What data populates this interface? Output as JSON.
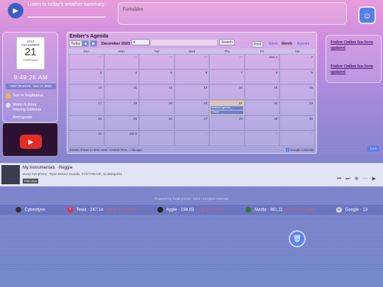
{
  "audio": {
    "text": "Listen to today's weather summary"
  },
  "forbidden": {
    "text": "Forbidden"
  },
  "date": {
    "year": "2023",
    "month": "DECEMBER",
    "day": "21",
    "weekday": "THURSDAY",
    "time": "9:49:26 AM",
    "gmt": "GMT 09:49:26 · Dec 21 2023"
  },
  "astro": [
    {
      "label": "Sun in Sagittarius",
      "color": "#e8c040"
    },
    {
      "label": "Moon in Aries",
      "color": "#dddddd"
    },
    {
      "label": "Waxing Gibbous",
      "color": "#888888"
    },
    {
      "label": "Retrograde",
      "color": "#aa88ee"
    }
  ],
  "calendar": {
    "title": "Ember's Agenda",
    "today_label": "Today",
    "month_label": "December 2023",
    "print_label": "Print",
    "week_label": "Week",
    "month_view_label": "Month",
    "agenda_label": "Agenda",
    "search_label": "Search",
    "weekdays": [
      "Sun",
      "Mon",
      "Tue",
      "Wed",
      "Thu",
      "Fri",
      "Sat"
    ],
    "days": [
      "26",
      "27",
      "28",
      "29",
      "30",
      "Dec 1",
      "2",
      "3",
      "4",
      "5",
      "6",
      "7",
      "8",
      "9",
      "10",
      "11",
      "12",
      "13",
      "14",
      "15",
      "16",
      "17",
      "18",
      "19",
      "20",
      "21",
      "22",
      "23",
      "24",
      "25",
      "26",
      "27",
      "28",
      "29",
      "30",
      "31",
      "Jan 1",
      "2",
      "3",
      "4",
      "5",
      "6"
    ],
    "event1": "embers agenda...",
    "event2": "Dinner ...",
    "footer": "Events shown in time zone: Central Time - Chicago",
    "gcal_label": "Google Calendar"
  },
  "online": {
    "link1": "Ember Online has been updated",
    "link2": "Ember Online has been updated"
  },
  "small_button": "HIDE",
  "player": {
    "title": "My Instrumentals · Reggie",
    "artists": "Scary Symphony · Ryan Deluca Sounds, SYNTHWAVE, ScottaSparks",
    "preview": "PREVIEW"
  },
  "powered": "Powered by TradingView · 2023 · All rights reserved",
  "ticker": [
    {
      "name": "Cyberdyne",
      "price": "",
      "change": "",
      "color": "#333333"
    },
    {
      "name": "Tesla",
      "price": "247.14",
      "change": "−10.90 (−4.22%)",
      "color": "#e03030"
    },
    {
      "name": "Apple",
      "price": "194.83",
      "change": "−2.11 (−1.07%)",
      "color": "#222222"
    },
    {
      "name": "Nvidia",
      "price": "481.11",
      "change": "−15.51 (−3.12%)",
      "color": "#2e7d32"
    },
    {
      "name": "Google",
      "price": "13",
      "change": "",
      "color": "#dddddd"
    }
  ]
}
